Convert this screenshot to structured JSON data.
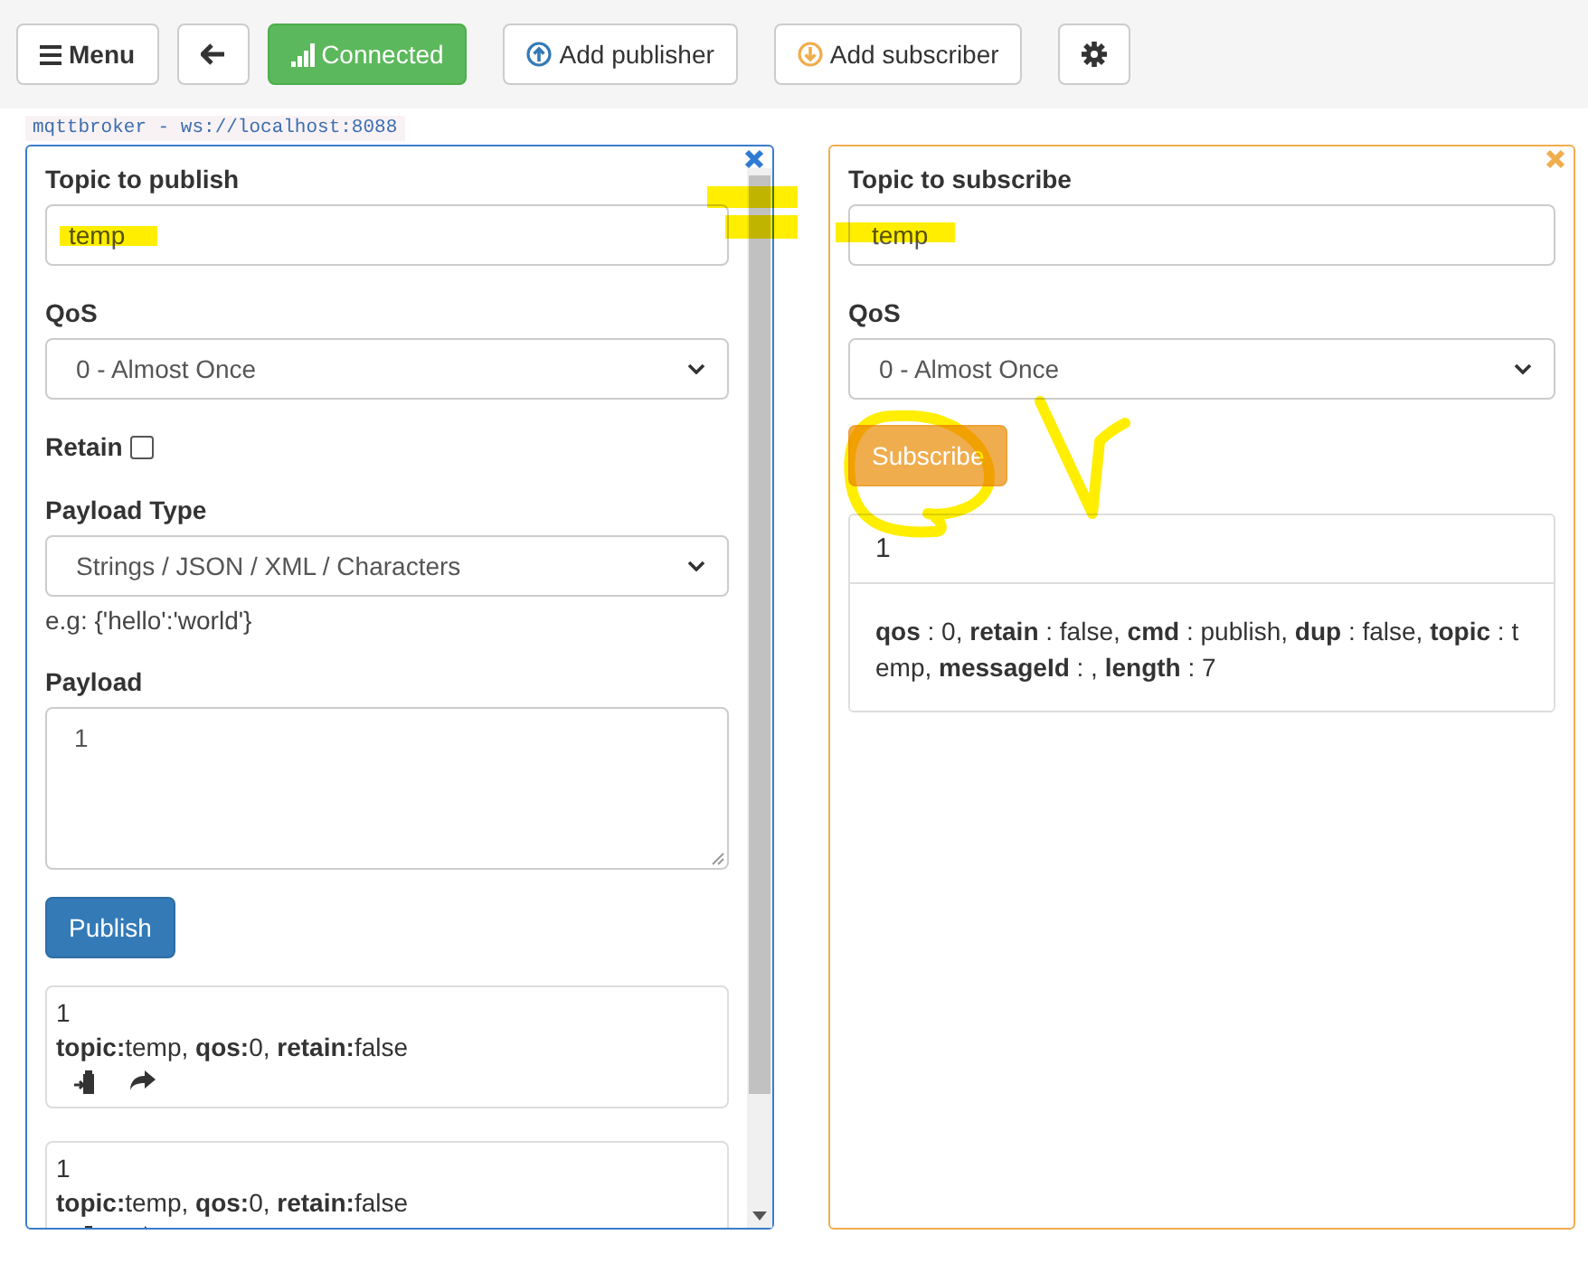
{
  "toolbar": [
    {
      "kind": "menu",
      "label": "Menu"
    },
    {
      "kind": "back"
    },
    {
      "kind": "connected",
      "label": "Connected"
    },
    {
      "kind": "add_publisher",
      "label": "Add publisher"
    },
    {
      "kind": "add_subscriber",
      "label": "Add subscriber"
    },
    {
      "kind": "settings"
    }
  ],
  "broker": "mqttbroker - ws://localhost:8088",
  "publisher": {
    "topic_label": "Topic to publish",
    "topic_value": "temp",
    "qos_label": "QoS",
    "qos_value": "0 - Almost Once",
    "retain_label": "Retain",
    "retain_checked": false,
    "payload_type_label": "Payload Type",
    "payload_type_value": "Strings / JSON / XML / Characters",
    "payload_hint": "e.g: {'hello':'world'}",
    "payload_label": "Payload",
    "payload_value": "1",
    "publish_button": "Publish",
    "messages": [
      {
        "payload": "1",
        "meta": "**topic:**temp, **qos:**0, **retain:**false"
      },
      {
        "payload": "1",
        "meta": "**topic:**temp, **qos:**0, **retain:**false"
      }
    ]
  },
  "subscriber": {
    "topic_label": "Topic to subscribe",
    "topic_value": "temp",
    "qos_label": "QoS",
    "qos_value": "0 - Almost Once",
    "subscribe_button": "Subscribe",
    "messages": [
      {
        "payload": "1",
        "meta": "**qos** : 0, **retain** : false, **cmd** : publish, **dup** : false, **topic** : temp, **messageId** : , **length** : 7"
      }
    ]
  }
}
